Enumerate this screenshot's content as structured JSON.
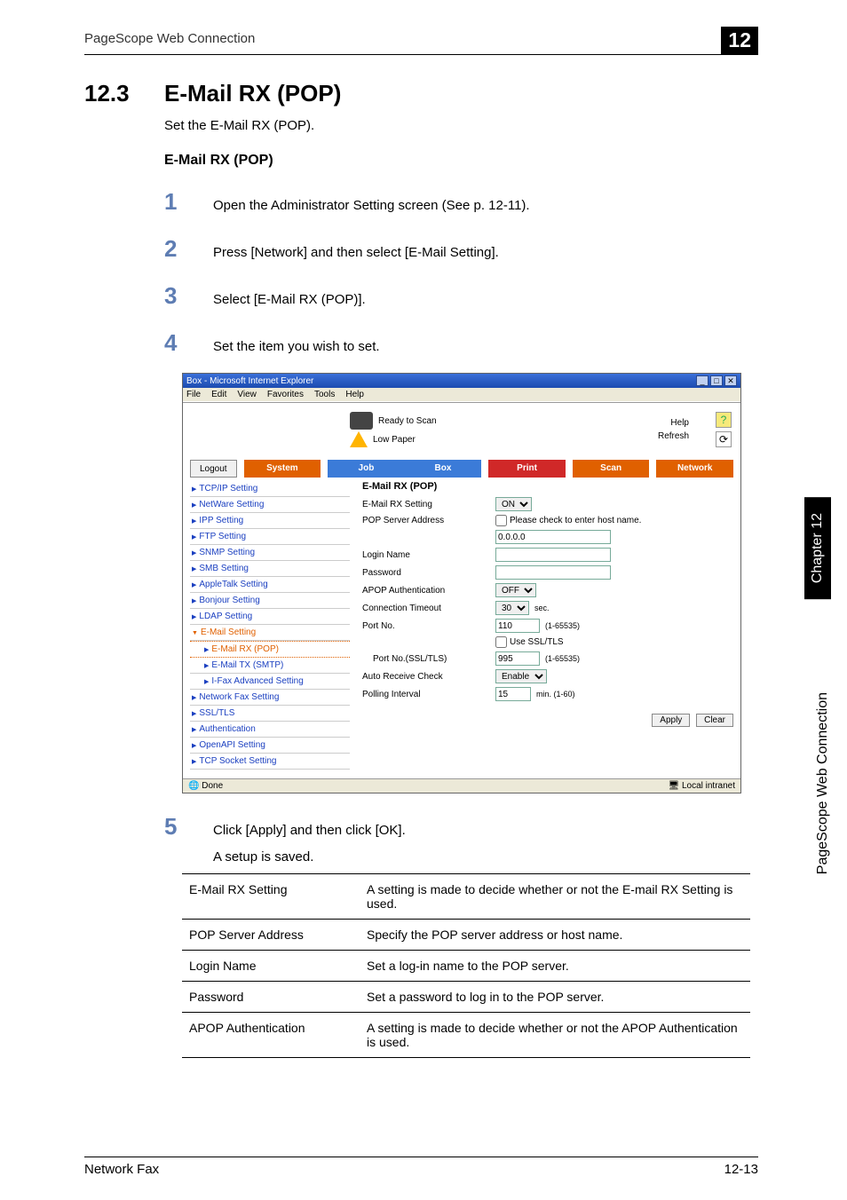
{
  "header": {
    "left": "PageScope Web Connection",
    "chapter_badge": "12"
  },
  "section": {
    "number": "12.3",
    "title": "E-Mail RX (POP)"
  },
  "intro": "Set the E-Mail RX (POP).",
  "subheading": "E-Mail RX (POP)",
  "steps": {
    "s1": "Open the Administrator Setting screen (See p. 12-11).",
    "s2": "Press [Network] and then select [E-Mail Setting].",
    "s3": "Select [E-Mail RX (POP)].",
    "s4": "Set the item you wish to set.",
    "s5": "Click [Apply] and then click [OK].",
    "s5_sub": "A setup is saved."
  },
  "shot": {
    "title": "Box - Microsoft Internet Explorer",
    "menus": [
      "File",
      "Edit",
      "View",
      "Favorites",
      "Tools",
      "Help"
    ],
    "status": {
      "ready": "Ready to Scan",
      "paper": "Low Paper",
      "help": "Help",
      "refresh": "Refresh"
    },
    "logout": "Logout",
    "tabs": {
      "system": "System",
      "job": "Job",
      "box": "Box",
      "print": "Print",
      "scan": "Scan",
      "network": "Network"
    },
    "sidebar": {
      "tcpip": "TCP/IP Setting",
      "netware": "NetWare Setting",
      "ipp": "IPP Setting",
      "ftp": "FTP Setting",
      "snmp": "SNMP Setting",
      "smb": "SMB Setting",
      "appletalk": "AppleTalk Setting",
      "bonjour": "Bonjour Setting",
      "ldap": "LDAP Setting",
      "email": "E-Mail Setting",
      "emailrx": "E-Mail RX (POP)",
      "emailtx": "E-Mail TX (SMTP)",
      "ifax": "I-Fax Advanced Setting",
      "netfax": "Network Fax Setting",
      "ssl": "SSL/TLS",
      "auth": "Authentication",
      "openapi": "OpenAPI Setting",
      "tcpsock": "TCP Socket Setting"
    },
    "form": {
      "heading": "E-Mail RX (POP)",
      "emailrx_lbl": "E-Mail RX Setting",
      "emailrx_val": "ON",
      "popaddr_lbl": "POP Server Address",
      "popaddr_chk": "Please check to enter host name.",
      "popaddr_val": "0.0.0.0",
      "login_lbl": "Login Name",
      "login_val": "",
      "pwd_lbl": "Password",
      "pwd_val": "",
      "apop_lbl": "APOP Authentication",
      "apop_val": "OFF",
      "conn_lbl": "Connection Timeout",
      "conn_val": "30",
      "conn_unit": "sec.",
      "port_lbl": "Port No.",
      "port_val": "110",
      "port_range": "(1-65535)",
      "usessl": "Use SSL/TLS",
      "portssl_lbl": "Port No.(SSL/TLS)",
      "portssl_val": "995",
      "portssl_range": "(1-65535)",
      "autorecv_lbl": "Auto Receive Check",
      "autorecv_val": "Enable",
      "poll_lbl": "Polling Interval",
      "poll_val": "15",
      "poll_unit": "min. (1-60)",
      "apply": "Apply",
      "clear": "Clear"
    },
    "statusbar": {
      "done": "Done",
      "zone": "Local intranet"
    }
  },
  "defs": [
    {
      "k": "E-Mail RX Setting",
      "v": "A setting is made to decide whether or not the E-mail RX Setting is used."
    },
    {
      "k": "POP Server Address",
      "v": "Specify the POP server address or host name."
    },
    {
      "k": "Login Name",
      "v": "Set a log-in name to the POP server."
    },
    {
      "k": "Password",
      "v": "Set a password to log in to the POP server."
    },
    {
      "k": "APOP Authentication",
      "v": "A setting is made to decide whether or not the APOP Authentication is used."
    }
  ],
  "footer": {
    "left": "Network Fax",
    "right": "12-13"
  },
  "side": {
    "black": "Chapter 12",
    "white": "PageScope Web Connection"
  }
}
